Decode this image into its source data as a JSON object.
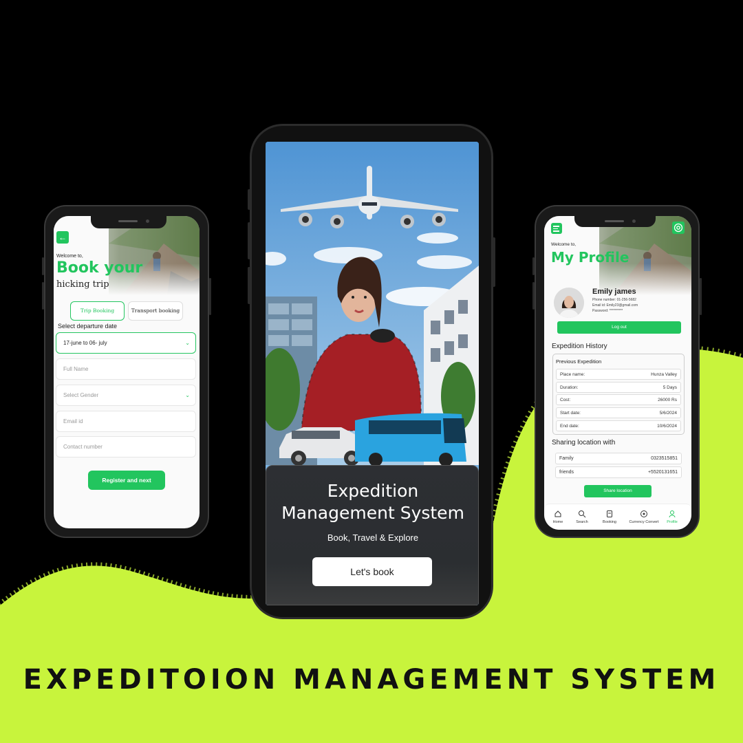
{
  "headline": "EXPEDITOION MANAGEMENT SYSTEM",
  "colors": {
    "accent": "#22c55e",
    "lime": "#c8f43c",
    "dark": "#111111"
  },
  "left": {
    "back_icon": "arrow-left-icon",
    "welcome": "Welcome to,",
    "title": "Book your",
    "subtitle": "hicking trip",
    "tabs": [
      "Trip Booking",
      "Transport booking"
    ],
    "departure_label": "Select departure date",
    "date_value": "17-june to 06- july",
    "fields": {
      "full_name": "Full Name",
      "gender": "Select Gender",
      "email": "Email id",
      "contact": "Contact number"
    },
    "submit": "Register and next"
  },
  "center": {
    "title_line1": "Expedition",
    "title_line2": "Management System",
    "tagline": "Book, Travel & Explore",
    "cta": "Let's book"
  },
  "right": {
    "menu_icon": "menu-icon",
    "settings_icon": "gear-icon",
    "welcome": "Welcome to,",
    "title": "My Profile",
    "profile": {
      "name": "Emily james",
      "phone": "Phone number: 01-256-5682",
      "email": "Email id: Emily23@gmail.com",
      "password": "Password: **********"
    },
    "logout": "Log out",
    "history_title": "Expedition History",
    "history_box_title": "Previous Expedition",
    "history": [
      {
        "k": "Place name:",
        "v": "Hunza Valley"
      },
      {
        "k": "Duration:",
        "v": "5 Days"
      },
      {
        "k": "Cost:",
        "v": "26000 Rs"
      },
      {
        "k": "Start date:",
        "v": "5/6/2024"
      },
      {
        "k": "End date:",
        "v": "10/6/2024"
      }
    ],
    "sharing_title": "Sharing location with",
    "sharing": [
      {
        "k": "Family",
        "v": "0323515851"
      },
      {
        "k": "friends",
        "v": "+5520131651"
      }
    ],
    "share_btn": "Share location",
    "nav": [
      "Home",
      "Search",
      "Booking",
      "Currency Convert",
      "Profile"
    ]
  }
}
